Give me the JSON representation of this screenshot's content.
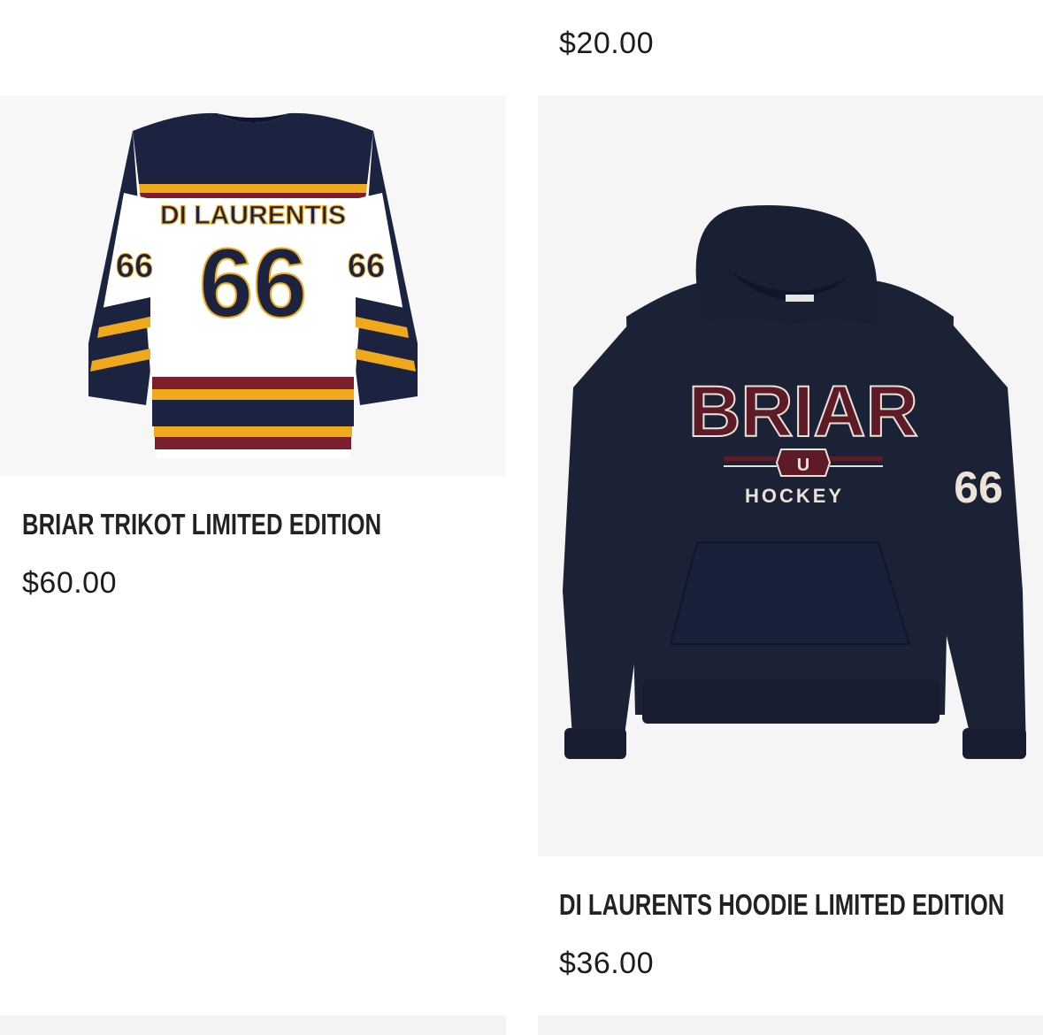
{
  "products": [
    {
      "title": "",
      "price": "$20.00",
      "image": "top-right-product-image-cropped"
    },
    {
      "title": "BRIAR TRIKOT LIMITED EDITION",
      "price": "$60.00",
      "image": "hockey-jersey-image",
      "print": {
        "name": "DI LAURENTIS",
        "number": "66"
      }
    },
    {
      "title": "DI LAURENTS HOODIE LIMITED EDITION",
      "price": "$36.00",
      "image": "navy-hoodie-image",
      "print": {
        "brand": "BRIAR",
        "crest": "U",
        "sub": "HOCKEY",
        "sleeve_number": "66"
      }
    }
  ],
  "colors": {
    "navy": "#1b2340",
    "gold": "#f0a81c",
    "maroon": "#7a1f2b",
    "hoodie": "#1c2236",
    "burgundy": "#5e1a26"
  }
}
